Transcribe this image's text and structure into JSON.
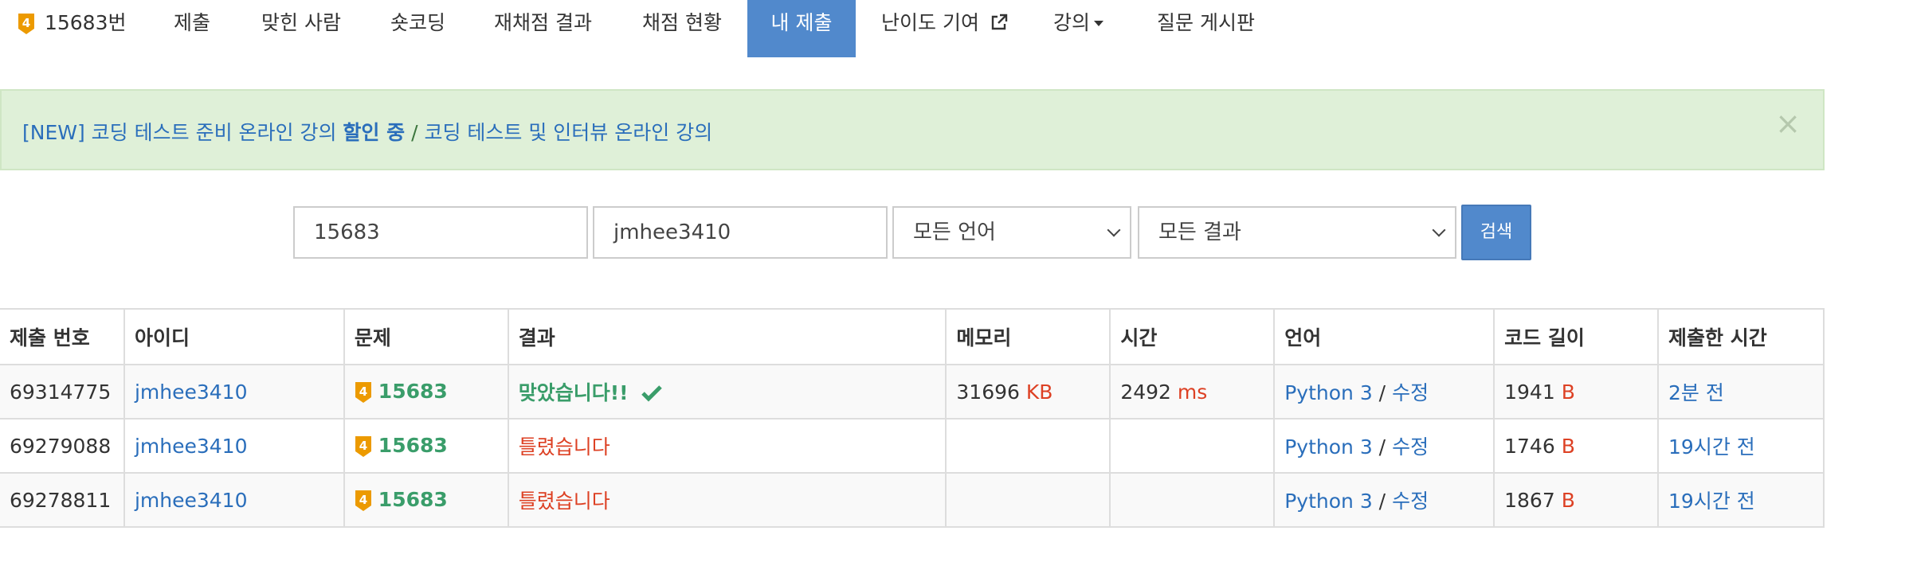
{
  "nav": {
    "problem_number": "15683번",
    "items": [
      {
        "label": "제출"
      },
      {
        "label": "맞힌 사람"
      },
      {
        "label": "숏코딩"
      },
      {
        "label": "재채점 결과"
      },
      {
        "label": "채점 현황"
      },
      {
        "label": "내 제출"
      },
      {
        "label": "난이도 기여"
      },
      {
        "label": "강의"
      },
      {
        "label": "질문 게시판"
      }
    ],
    "active_index": 5
  },
  "alert": {
    "part1": "[NEW] 코딩 테스트 준비 온라인 강의",
    "part2": "할인 중",
    "sep": " / ",
    "part3": "코딩 테스트 및 인터뷰 온라인 강의",
    "close": "×"
  },
  "search": {
    "problem_id": "15683",
    "user_id": "jmhee3410",
    "language": "모든 언어",
    "result": "모든 결과",
    "button": "검색"
  },
  "table": {
    "headers": [
      "제출 번호",
      "아이디",
      "문제",
      "결과",
      "메모리",
      "시간",
      "언어",
      "코드 길이",
      "제출한 시간"
    ],
    "rows": [
      {
        "id": "69314775",
        "user": "jmhee3410",
        "problem": "15683",
        "result": "맞았습니다!!",
        "result_type": "ok",
        "memory": "31696",
        "memory_unit": "KB",
        "time": "2492",
        "time_unit": "ms",
        "lang": "Python 3",
        "lang_sep": " / ",
        "edit": "수정",
        "code_len": "1941",
        "code_unit": "B",
        "when": "2분 전"
      },
      {
        "id": "69279088",
        "user": "jmhee3410",
        "problem": "15683",
        "result": "틀렸습니다",
        "result_type": "wa",
        "memory": "",
        "memory_unit": "",
        "time": "",
        "time_unit": "",
        "lang": "Python 3",
        "lang_sep": " / ",
        "edit": "수정",
        "code_len": "1746",
        "code_unit": "B",
        "when": "19시간 전"
      },
      {
        "id": "69278811",
        "user": "jmhee3410",
        "problem": "15683",
        "result": "틀렸습니다",
        "result_type": "wa",
        "memory": "",
        "memory_unit": "",
        "time": "",
        "time_unit": "",
        "lang": "Python 3",
        "lang_sep": " / ",
        "edit": "수정",
        "code_len": "1867",
        "code_unit": "B",
        "when": "19시간 전"
      }
    ]
  },
  "colors": {
    "accent": "#5189cc",
    "link": "#2a6ebb",
    "accepted": "#3a9d6a",
    "wrong": "#dd4124",
    "tier_gold": "#ec9a00"
  },
  "icons": {
    "tier": "gold-tier-4-icon",
    "external": "external-link-icon",
    "dropdown": "caret-down-icon",
    "check": "check-icon",
    "close": "close-icon"
  }
}
